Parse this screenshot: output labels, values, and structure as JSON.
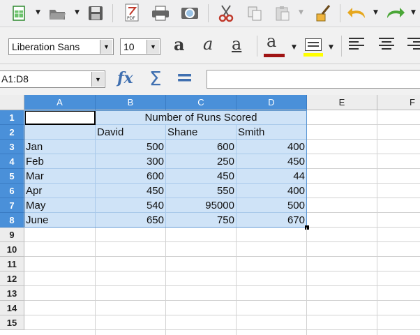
{
  "toolbar": {
    "icons": [
      "new-spreadsheet-icon",
      "open-icon",
      "save-icon",
      "export-pdf-icon",
      "print-icon",
      "print-preview-icon",
      "cut-icon",
      "copy-icon",
      "paste-icon",
      "clone-formatting-icon",
      "undo-icon",
      "redo-icon"
    ],
    "pdf_label": "PDF"
  },
  "format": {
    "font_name": "Liberation Sans",
    "font_size": "10",
    "bold_glyph": "a",
    "italic_glyph": "a",
    "underline_glyph": "a",
    "font_color_glyph": "a",
    "font_color": "#a01414",
    "highlight_color": "#ffff00"
  },
  "formula_bar": {
    "name_box": "A1:D8",
    "fx_label": "fx",
    "sum_label": "Σ",
    "equals_label": "=",
    "input_value": ""
  },
  "sheet": {
    "columns": [
      "A",
      "B",
      "C",
      "D",
      "E",
      "F"
    ],
    "rows": [
      "1",
      "2",
      "3",
      "4",
      "5",
      "6",
      "7",
      "8",
      "9",
      "10",
      "11",
      "12",
      "13",
      "14",
      "15"
    ],
    "title": "Number of Runs Scored",
    "headers": [
      "David",
      "Shane",
      "Smith"
    ],
    "data": [
      {
        "label": "Jan",
        "values": [
          "500",
          "600",
          "400"
        ]
      },
      {
        "label": "Feb",
        "values": [
          "300",
          "250",
          "450"
        ]
      },
      {
        "label": "Mar",
        "values": [
          "600",
          "450",
          "44"
        ]
      },
      {
        "label": "Apr",
        "values": [
          "450",
          "550",
          "400"
        ]
      },
      {
        "label": "May",
        "values": [
          "540",
          "95000",
          "500"
        ]
      },
      {
        "label": "June",
        "values": [
          "650",
          "750",
          "670"
        ]
      }
    ],
    "selection": "A1:D8",
    "selection_color": "#cfe3f7",
    "header_selected_color": "#4a90d9"
  }
}
